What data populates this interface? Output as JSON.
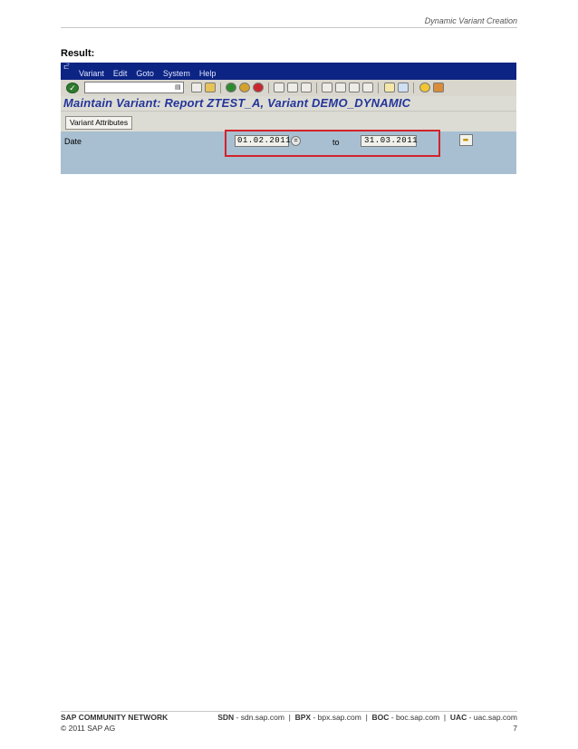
{
  "header": {
    "title": "Dynamic Variant Creation"
  },
  "result_label": "Result:",
  "sap": {
    "menu": [
      "Variant",
      "Edit",
      "Goto",
      "System",
      "Help"
    ],
    "title": "Maintain Variant: Report ZTEST_A, Variant DEMO_DYNAMIC",
    "app_toolbar": {
      "variant_attributes": "Variant Attributes"
    },
    "fields": {
      "date_label": "Date",
      "date_from": "01.02.2011",
      "to_label": "to",
      "date_to": "31.03.2011"
    },
    "icons": {
      "enter": "check-icon",
      "save": "save-icon",
      "back": "back-icon",
      "exit": "exit-icon",
      "cancel": "cancel-icon",
      "help": "help-icon",
      "multiple_selection": "arrow-right-icon"
    },
    "colors": {
      "menubar": "#0c2483",
      "content_bg": "#a8bfd1",
      "highlight": "#d2232a",
      "title": "#25359a"
    }
  },
  "footer": {
    "network": "SAP COMMUNITY NETWORK",
    "links": [
      {
        "label": "SDN",
        "url": "sdn.sap.com"
      },
      {
        "label": "BPX",
        "url": "bpx.sap.com"
      },
      {
        "label": "BOC",
        "url": "boc.sap.com"
      },
      {
        "label": "UAC",
        "url": "uac.sap.com"
      }
    ],
    "copyright": "© 2011 SAP AG",
    "page": "7"
  }
}
